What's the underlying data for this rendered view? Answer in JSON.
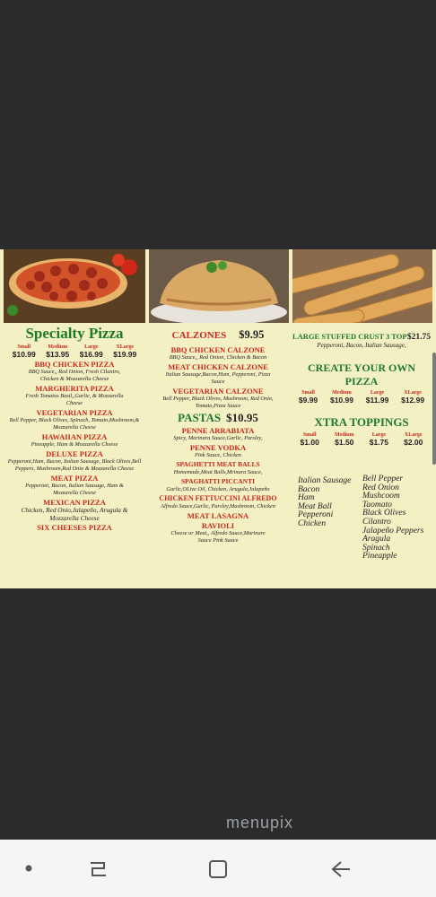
{
  "menu": {
    "specialty": {
      "title": "Specialty Pizza",
      "sizes": [
        "Small",
        "Medium",
        "Large",
        "XLarge"
      ],
      "prices": [
        "$10.99",
        "$13.95",
        "$16.99",
        "$19.99"
      ],
      "items": [
        {
          "name": "BBQ CHICKEN PIZZA",
          "desc": "BBQ Sauce,, Red Onion, Fresh Cilantro, Chicken & Mozzarella Cheese"
        },
        {
          "name": "MARGHERITA PIZZA",
          "desc": "Fresh Tomatos Basil,,Garlic, & Mozzarella Cheese"
        },
        {
          "name": "VEGETARIAN PIZZA",
          "desc": "Bell Pepper, Black Olives, Spinach, Tomato,Mushroom,& Mozzarella Cheese"
        },
        {
          "name": "HAWAIIAN PIZZA",
          "desc": "Pineapple, Ham & Mozzarella Cheese"
        },
        {
          "name": "DELUXE PIZZA",
          "desc": "Pepperoni,Ham, Bacon, Italian Sausage, Black Olives,Bell Peppers, Mushroom,Red Onio & Mozzarella Cheese"
        },
        {
          "name": "MEAT PIZZA",
          "desc": "Pepperoni, Bacon, Italian Sausage, Ham & Mozzarella Cheese"
        },
        {
          "name": "MEXICAN PIZZA",
          "desc": "Chicken, Red Onio,Jalapeño, Arugula & Mozzarella Cheese"
        },
        {
          "name": "SIX CHEESES PIZZA",
          "desc": ""
        }
      ]
    },
    "calzones": {
      "title": "CALZONES",
      "price": "$9.95",
      "items": [
        {
          "name": "BBQ CHICKEN CALZONE",
          "desc": "BBQ Sauce,, Red Onion, Chicken & Bacon"
        },
        {
          "name": "MEAT CHICKEN CALZONE",
          "desc": "Italian Sausage,Bacon,Ham, Pepperoni, Pizza Sauce"
        },
        {
          "name": "VEGETARIAN CALZONE",
          "desc": "Bell Pepper, Black Olives, Mushroom, Red Onio, Tomato,Pizza Sauce"
        }
      ]
    },
    "pastas": {
      "title": "PASTAS",
      "price": "$10.95",
      "items": [
        {
          "name": "PENNE ARRABIATA",
          "desc": "Spicy, Marinara Sauce,Garlic, Parsley,"
        },
        {
          "name": "PENNE VODKA",
          "desc": "Pink Sauce, Chicken"
        },
        {
          "name": "SPAGHETTI MEAT BALLS",
          "desc": "Homemade,Meat Balls,Mrinara Sauce,"
        },
        {
          "name": "SPAGHATTI PICCANTI",
          "desc": "Garlic,OLive Oil, Chicken, Arugula,Jalapeño"
        },
        {
          "name": "CHICKEN FETTUCCINI ALFREDO",
          "desc": "Alfredo Sauce,Garlic, Parsley,Mushroom, Chicken"
        },
        {
          "name": "MEAT LASAGNA",
          "desc": ""
        },
        {
          "name": "RAVIOLI",
          "desc": "Cheese or Meat,, Alfredo Sauce,Marinare Sauce Pink Sauce"
        }
      ]
    },
    "stuffed": {
      "title": "LARGE STUFFED CRUST 3 TOP",
      "price": "$21.75",
      "desc": "Pepperoni, Bacon, Italian Sausage,"
    },
    "create": {
      "title": "CREATE YOUR OWN PIZZA",
      "sizes": [
        "Small",
        "Medium",
        "Large",
        "XLarge"
      ],
      "prices": [
        "$9.99",
        "$10.99",
        "$11.99",
        "$12.99"
      ]
    },
    "xtra": {
      "title": "XTRA TOPPINGS",
      "sizes": [
        "Small",
        "Medium",
        "Large",
        "XLarge"
      ],
      "prices": [
        "$1.00",
        "$1.50",
        "$1.75",
        "$2.00"
      ],
      "toppings_left": [
        "Italian Sausage",
        "Bacon",
        "Ham",
        "Meat Ball",
        "Pepperoni",
        "Chicken"
      ],
      "toppings_right": [
        "Bell Pepper",
        "Red Onion",
        "Mushcoom",
        "Taomato",
        "Black Olives",
        "Cilantro",
        "Jalapeño Peppers",
        "Aragula",
        "Spinach",
        "Pineapple"
      ]
    }
  },
  "watermark": "menupix",
  "colors": {
    "red": "#c8281c",
    "green": "#1f7a2a",
    "menu_bg": "#f3f0c4",
    "page_bg": "#2b2b2b"
  },
  "nav": {
    "icons": [
      "dot-icon",
      "recent-apps-icon",
      "home-icon",
      "back-icon"
    ]
  }
}
